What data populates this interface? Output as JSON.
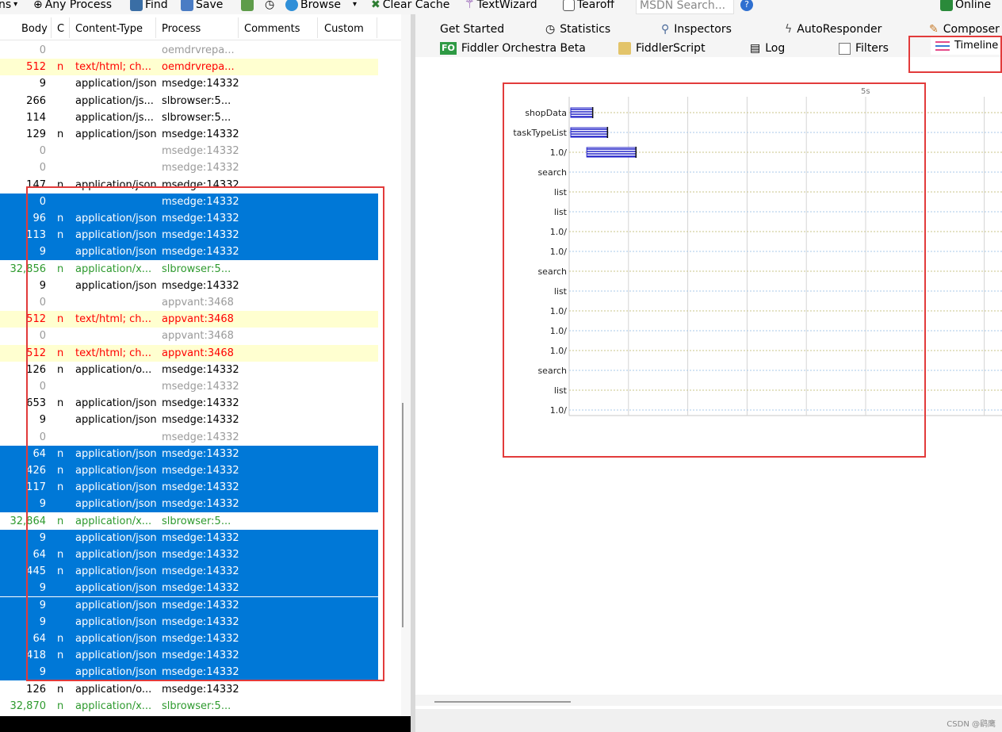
{
  "toolbar": {
    "items": [
      {
        "label": "ns",
        "icon": "dropdown-icon"
      },
      {
        "label": "Any Process",
        "icon": "crosshair-icon"
      },
      {
        "label": "Find",
        "icon": "binoculars-icon"
      },
      {
        "label": "Save",
        "icon": "save-icon"
      },
      {
        "label": "",
        "icon": "capture-icon"
      },
      {
        "label": "",
        "icon": "timer-icon"
      },
      {
        "label": "Browse",
        "icon": "ie-icon"
      },
      {
        "label": "Clear Cache",
        "icon": "clear-cache-icon"
      },
      {
        "label": "TextWizard",
        "icon": "wizard-icon"
      },
      {
        "label": "Tearoff",
        "icon": "tearoff-icon"
      },
      {
        "label": "Online",
        "icon": "online-icon"
      }
    ],
    "search_placeholder": "MSDN Search..."
  },
  "columns": [
    "Body",
    "C",
    "Content-Type",
    "Process",
    "Comments",
    "Custom"
  ],
  "rows": [
    {
      "body": "0",
      "c": "",
      "ct": "",
      "process": "oemdrvrepa...",
      "style": "gray"
    },
    {
      "body": "512",
      "c": "n",
      "ct": "text/html; ch...",
      "process": "oemdrvrepa...",
      "style": "red"
    },
    {
      "body": "9",
      "c": "",
      "ct": "application/json",
      "process": "msedge:14332",
      "style": "normal"
    },
    {
      "body": "266",
      "c": "",
      "ct": "application/js...",
      "process": "slbrowser:5...",
      "style": "normal"
    },
    {
      "body": "114",
      "c": "",
      "ct": "application/js...",
      "process": "slbrowser:5...",
      "style": "normal"
    },
    {
      "body": "129",
      "c": "n",
      "ct": "application/json",
      "process": "msedge:14332",
      "style": "normal"
    },
    {
      "body": "0",
      "c": "",
      "ct": "",
      "process": "msedge:14332",
      "style": "gray"
    },
    {
      "body": "0",
      "c": "",
      "ct": "",
      "process": "msedge:14332",
      "style": "gray"
    },
    {
      "body": "147",
      "c": "n",
      "ct": "application/json",
      "process": "msedge:14332",
      "style": "normal"
    },
    {
      "body": "0",
      "c": "",
      "ct": "",
      "process": "msedge:14332",
      "style": "selected"
    },
    {
      "body": "96",
      "c": "n",
      "ct": "application/json",
      "process": "msedge:14332",
      "style": "selected"
    },
    {
      "body": "113",
      "c": "n",
      "ct": "application/json",
      "process": "msedge:14332",
      "style": "selected"
    },
    {
      "body": "9",
      "c": "",
      "ct": "application/json",
      "process": "msedge:14332",
      "style": "selected"
    },
    {
      "body": "32,856",
      "c": "n",
      "ct": "application/x...",
      "process": "slbrowser:5...",
      "style": "green"
    },
    {
      "body": "9",
      "c": "",
      "ct": "application/json",
      "process": "msedge:14332",
      "style": "normal"
    },
    {
      "body": "0",
      "c": "",
      "ct": "",
      "process": "appvant:3468",
      "style": "gray"
    },
    {
      "body": "512",
      "c": "n",
      "ct": "text/html; ch...",
      "process": "appvant:3468",
      "style": "red"
    },
    {
      "body": "0",
      "c": "",
      "ct": "",
      "process": "appvant:3468",
      "style": "gray"
    },
    {
      "body": "512",
      "c": "n",
      "ct": "text/html; ch...",
      "process": "appvant:3468",
      "style": "red"
    },
    {
      "body": "126",
      "c": "n",
      "ct": "application/o...",
      "process": "msedge:14332",
      "style": "normal"
    },
    {
      "body": "0",
      "c": "",
      "ct": "",
      "process": "msedge:14332",
      "style": "gray"
    },
    {
      "body": "653",
      "c": "n",
      "ct": "application/json",
      "process": "msedge:14332",
      "style": "normal"
    },
    {
      "body": "9",
      "c": "",
      "ct": "application/json",
      "process": "msedge:14332",
      "style": "normal"
    },
    {
      "body": "0",
      "c": "",
      "ct": "",
      "process": "msedge:14332",
      "style": "gray"
    },
    {
      "body": "64",
      "c": "n",
      "ct": "application/json",
      "process": "msedge:14332",
      "style": "selected"
    },
    {
      "body": "426",
      "c": "n",
      "ct": "application/json",
      "process": "msedge:14332",
      "style": "selected"
    },
    {
      "body": "117",
      "c": "n",
      "ct": "application/json",
      "process": "msedge:14332",
      "style": "selected"
    },
    {
      "body": "9",
      "c": "",
      "ct": "application/json",
      "process": "msedge:14332",
      "style": "selected"
    },
    {
      "body": "32,864",
      "c": "n",
      "ct": "application/x...",
      "process": "slbrowser:5...",
      "style": "green"
    },
    {
      "body": "9",
      "c": "",
      "ct": "application/json",
      "process": "msedge:14332",
      "style": "selected"
    },
    {
      "body": "64",
      "c": "n",
      "ct": "application/json",
      "process": "msedge:14332",
      "style": "selected"
    },
    {
      "body": "445",
      "c": "n",
      "ct": "application/json",
      "process": "msedge:14332",
      "style": "selected"
    },
    {
      "body": "9",
      "c": "",
      "ct": "application/json",
      "process": "msedge:14332",
      "style": "selected"
    },
    {
      "body": "9",
      "c": "",
      "ct": "application/json",
      "process": "msedge:14332",
      "style": "selected"
    },
    {
      "body": "9",
      "c": "",
      "ct": "application/json",
      "process": "msedge:14332",
      "style": "selected"
    },
    {
      "body": "64",
      "c": "n",
      "ct": "application/json",
      "process": "msedge:14332",
      "style": "selected"
    },
    {
      "body": "418",
      "c": "n",
      "ct": "application/json",
      "process": "msedge:14332",
      "style": "selected"
    },
    {
      "body": "9",
      "c": "",
      "ct": "application/json",
      "process": "msedge:14332",
      "style": "selected"
    },
    {
      "body": "126",
      "c": "n",
      "ct": "application/o...",
      "process": "msedge:14332",
      "style": "normal"
    },
    {
      "body": "32,870",
      "c": "n",
      "ct": "application/x...",
      "process": "slbrowser:5...",
      "style": "green"
    }
  ],
  "tabs": {
    "row1": [
      {
        "label": "Get Started",
        "icon": ""
      },
      {
        "label": "Statistics",
        "icon": "stopwatch-icon"
      },
      {
        "label": "Inspectors",
        "icon": "inspectors-icon"
      },
      {
        "label": "AutoResponder",
        "icon": "lightning-icon"
      },
      {
        "label": "Composer",
        "icon": "composer-icon"
      }
    ],
    "row2": [
      {
        "label": "Fiddler Orchestra Beta",
        "icon": "fo-icon",
        "badge": "FO"
      },
      {
        "label": "FiddlerScript",
        "icon": "js-icon"
      },
      {
        "label": "Log",
        "icon": "log-icon"
      },
      {
        "label": "Filters",
        "icon": "checkbox-icon"
      },
      {
        "label": "Timeline",
        "icon": "timeline-icon",
        "active": true
      }
    ]
  },
  "timeline": {
    "scale_label": "5s",
    "labels": [
      "shopData",
      "taskTypeList",
      "1.0/",
      "search",
      "list",
      "list",
      "1.0/",
      "1.0/",
      "search",
      "list",
      "1.0/",
      "1.0/",
      "1.0/",
      "search",
      "list",
      "1.0/"
    ],
    "bars": [
      {
        "start": 0.0,
        "end": 0.37
      },
      {
        "start": 0.0,
        "end": 0.62
      },
      {
        "start": 0.27,
        "end": 1.1
      },
      {
        "start": 0,
        "end": 0
      },
      {
        "start": 0,
        "end": 0
      },
      {
        "start": 0,
        "end": 0
      },
      {
        "start": 0,
        "end": 0
      },
      {
        "start": 0,
        "end": 0
      },
      {
        "start": 0,
        "end": 0
      },
      {
        "start": 0,
        "end": 0
      },
      {
        "start": 0,
        "end": 0
      },
      {
        "start": 0,
        "end": 0
      },
      {
        "start": 0,
        "end": 0
      },
      {
        "start": 0,
        "end": 0
      },
      {
        "start": 0,
        "end": 0
      },
      {
        "start": 0,
        "end": 0
      }
    ],
    "bar_color": "#2323c8"
  },
  "watermark": "CSDN @鹞鹰",
  "colors": {
    "selection": "#0078d7",
    "error_row": "#ffffd0",
    "highlight_box": "#e23b3b"
  }
}
